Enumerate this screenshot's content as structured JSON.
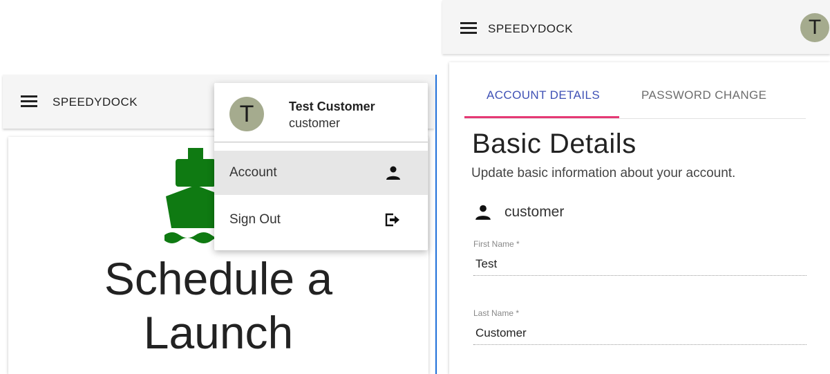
{
  "left": {
    "appbar": {
      "brand": "SPEEDYDOCK"
    },
    "hero": {
      "line1": "Schedule a",
      "line2": "Launch"
    },
    "user_menu": {
      "avatar_letter": "T",
      "name": "Test Customer",
      "role": "customer",
      "items": [
        {
          "label": "Account",
          "icon": "person-icon",
          "active": true
        },
        {
          "label": "Sign Out",
          "icon": "sign-out-icon",
          "active": false
        }
      ]
    }
  },
  "right": {
    "appbar": {
      "brand": "SPEEDYDOCK",
      "avatar_letter": "T"
    },
    "tabs": [
      {
        "label": "ACCOUNT DETAILS",
        "active": true
      },
      {
        "label": "PASSWORD CHANGE",
        "active": false
      }
    ],
    "section": {
      "title": "Basic Details",
      "subtitle": "Update basic information about your account.",
      "username": "customer"
    },
    "fields": {
      "first_name": {
        "label": "First Name *",
        "value": "Test"
      },
      "last_name": {
        "label": "Last Name *",
        "value": "Customer"
      }
    }
  },
  "colors": {
    "appbar_bg": "#f5f5f5",
    "ship_green": "#0f7a12",
    "tab_active": "#3f51b5",
    "tab_indicator": "#e53974",
    "avatar_bg": "#a5ab8e",
    "menu_active_bg": "#e6e6e6"
  }
}
